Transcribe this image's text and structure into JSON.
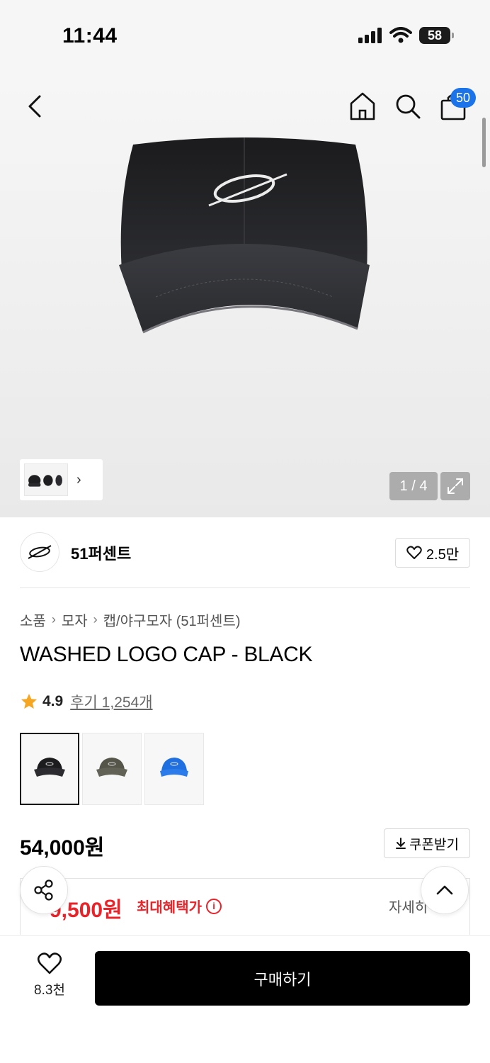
{
  "status_bar": {
    "time": "11:44",
    "battery": "58"
  },
  "header": {
    "cart_count": "50"
  },
  "gallery": {
    "page_counter": "1 / 4"
  },
  "brand": {
    "name": "51퍼센트",
    "likes": "2.5만"
  },
  "breadcrumb": {
    "items": [
      "소품",
      "모자",
      "캡/야구모자 (51퍼센트)"
    ]
  },
  "product": {
    "title": "WASHED LOGO CAP - BLACK",
    "rating": "4.9",
    "reviews": "후기 1,254개",
    "colors": [
      "black",
      "khaki",
      "blue"
    ],
    "price": "54,000원",
    "coupon_label": "쿠폰받기",
    "benefit_price": "9,500원",
    "benefit_label": "최대혜택가",
    "benefit_detail": "자세히"
  },
  "bottom": {
    "wish_count": "8.3천",
    "buy_label": "구매하기"
  },
  "colors": {
    "accent_blue": "#1a73e8",
    "sale_red": "#e8232a",
    "star": "#f5a623"
  }
}
